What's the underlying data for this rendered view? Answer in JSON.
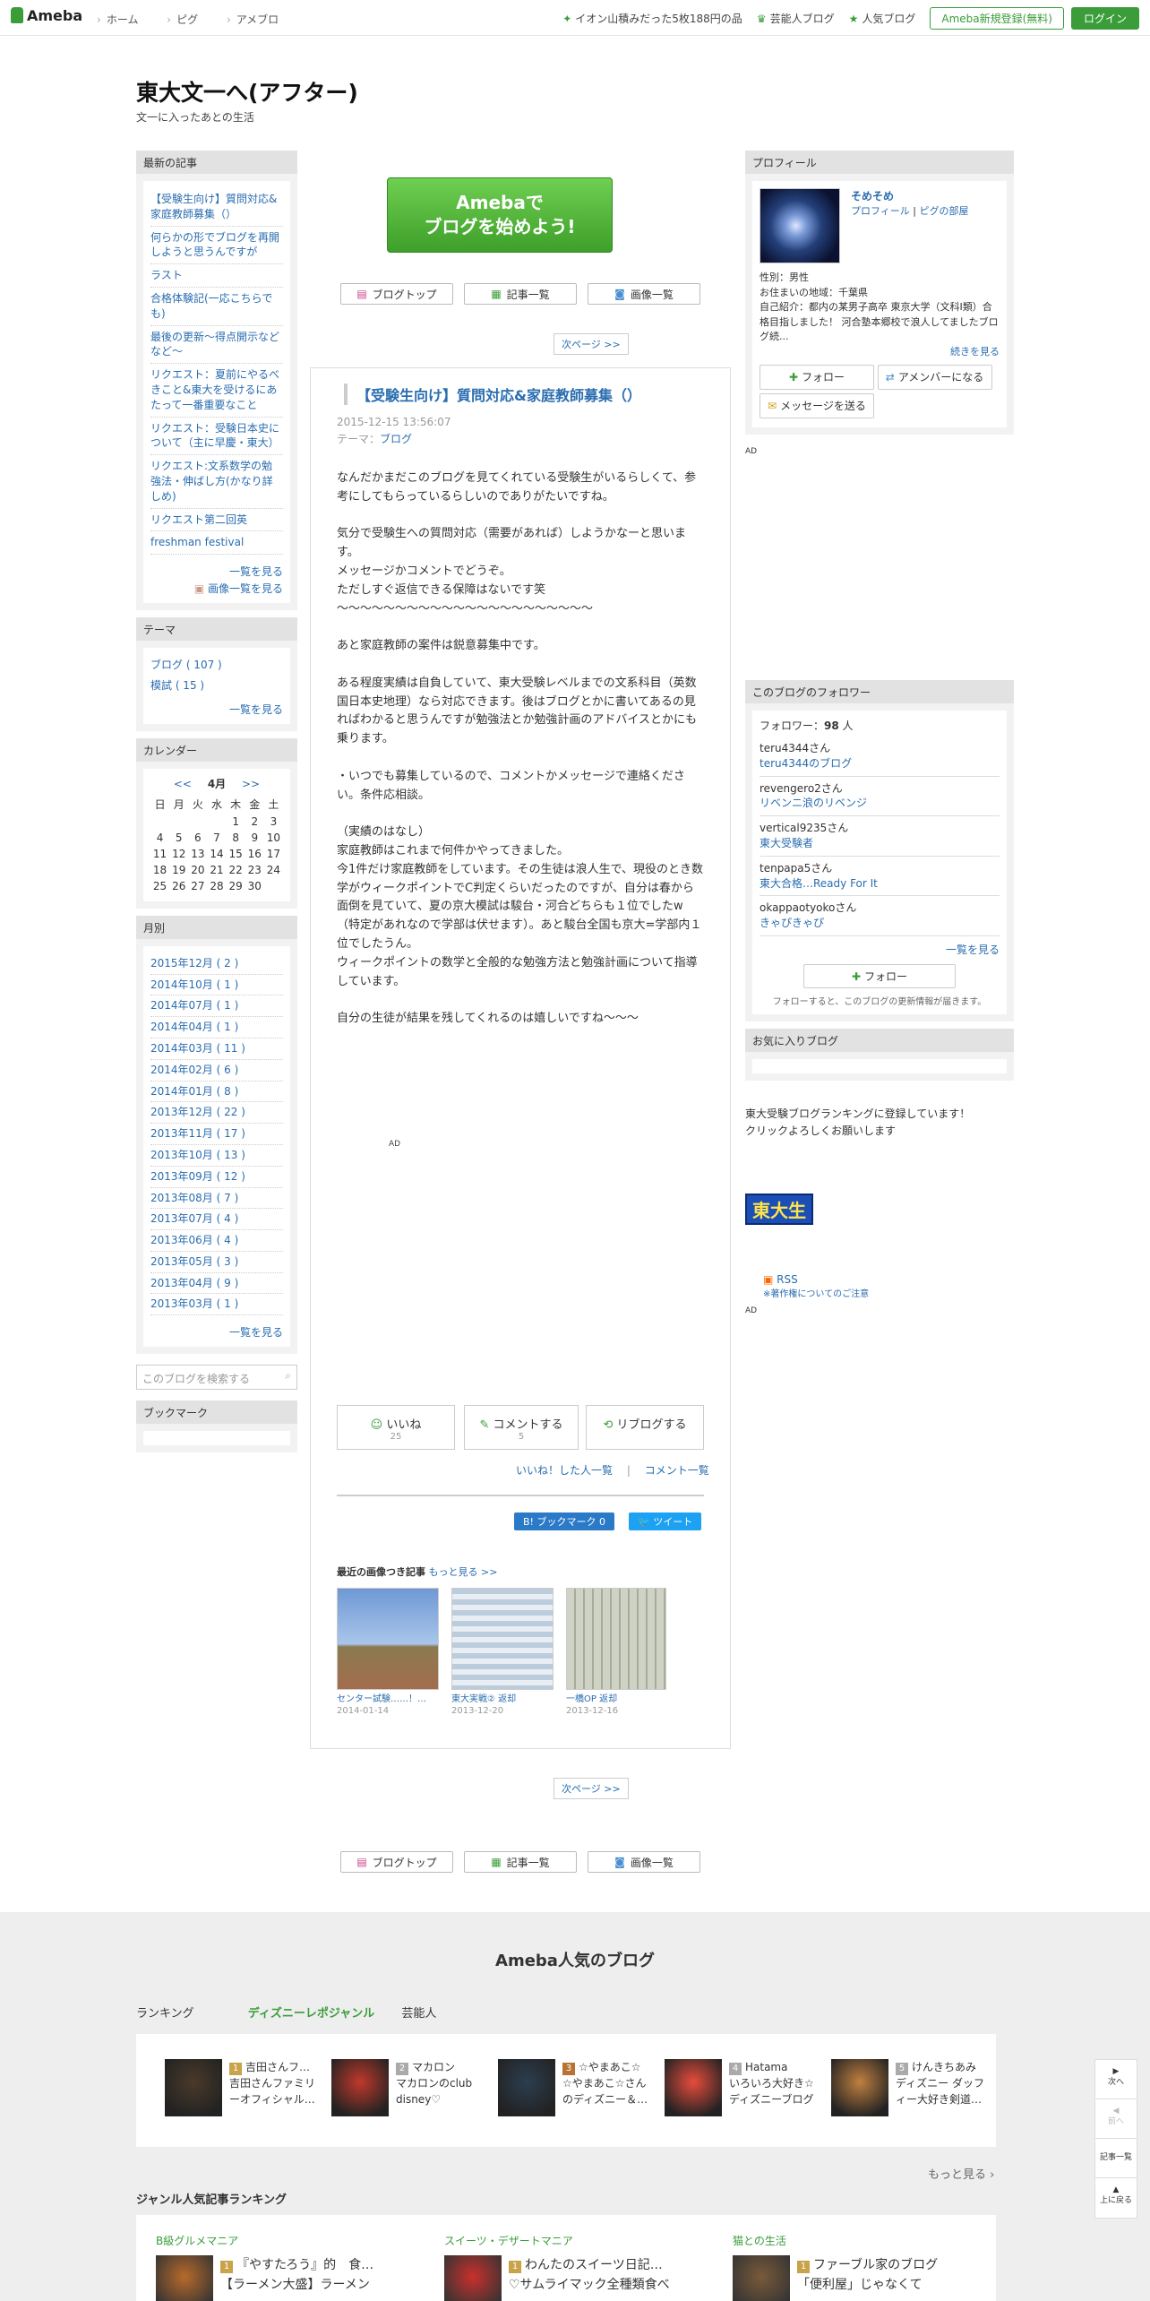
{
  "header": {
    "logo": "Ameba",
    "nav": [
      "ホーム",
      "ピグ",
      "アメブロ"
    ],
    "promo": "イオン山積みだった5枚188円の品",
    "links": [
      "芸能人ブログ",
      "人気ブログ"
    ],
    "register": "Ameba新規登録(無料)",
    "login": "ログイン"
  },
  "blog": {
    "title": "東大文一へ(アフター)",
    "description": "文一に入ったあとの生活"
  },
  "recent": {
    "heading": "最新の記事",
    "items": [
      "【受験生向け】質問対応&家庭教師募集（）",
      "何らかの形でブログを再開しようと思うんですが",
      "ラスト",
      "合格体験記(一応こちらでも)",
      "最後の更新～得点開示などなど～",
      "リクエスト：夏前にやるべきこと&東大を受けるにあたって一番重要なこと",
      "リクエスト：受験日本史について（主に早慶・東大）",
      "リクエスト:文系数学の勉強法・伸ばし方(かなり詳しめ)",
      "リクエスト第二回英",
      "freshman festival"
    ],
    "more": "一覧を見る",
    "images": "画像一覧を見る"
  },
  "theme": {
    "heading": "テーマ",
    "items": [
      "ブログ ( 107 )",
      "模試 ( 15 )"
    ],
    "more": "一覧を見る"
  },
  "calendar": {
    "heading": "カレンダー",
    "prev": "<<",
    "month": "4月",
    "next": ">>",
    "days": [
      "日",
      "月",
      "火",
      "水",
      "木",
      "金",
      "土"
    ],
    "weeks": [
      [
        "",
        "",
        "",
        "",
        "1",
        "2",
        "3"
      ],
      [
        "4",
        "5",
        "6",
        "7",
        "8",
        "9",
        "10"
      ],
      [
        "11",
        "12",
        "13",
        "14",
        "15",
        "16",
        "17"
      ],
      [
        "18",
        "19",
        "20",
        "21",
        "22",
        "23",
        "24"
      ],
      [
        "25",
        "26",
        "27",
        "28",
        "29",
        "30",
        ""
      ]
    ]
  },
  "monthly": {
    "heading": "月別",
    "items": [
      "2015年12月 ( 2 )",
      "2014年10月 ( 1 )",
      "2014年07月 ( 1 )",
      "2014年04月 ( 1 )",
      "2014年03月 ( 11 )",
      "2014年02月 ( 6 )",
      "2014年01月 ( 8 )",
      "2013年12月 ( 22 )",
      "2013年11月 ( 17 )",
      "2013年10月 ( 13 )",
      "2013年09月 ( 12 )",
      "2013年08月 ( 7 )",
      "2013年07月 ( 4 )",
      "2013年06月 ( 4 )",
      "2013年05月 ( 3 )",
      "2013年04月 ( 9 )",
      "2013年03月 ( 1 )"
    ],
    "more": "一覧を見る"
  },
  "search": {
    "placeholder": "このブログを検索する"
  },
  "bookmark": {
    "heading": "ブックマーク"
  },
  "center": {
    "banner_line1": "Amebaで",
    "banner_line2": "ブログを始めよう!",
    "nav": [
      "ブログトップ",
      "記事一覧",
      "画像一覧"
    ],
    "next": "次ページ >>"
  },
  "entry": {
    "title": "【受験生向け】質問対応&家庭教師募集（）",
    "date": "2015-12-15 13:56:07",
    "theme_label": "テーマ：",
    "theme": "ブログ",
    "body": "なんだかまだこのブログを見てくれている受験生がいるらしくて、参考にしてもらっているらしいのでありがたいですね。\n\n気分で受験生への質問対応（需要があれば）しようかなーと思います。\nメッセージかコメントでどうぞ。\nただしすぐ返信できる保障はないです笑\n～～～～～～～～～～～～～～～～～～～～～～\n\nあと家庭教師の案件は鋭意募集中です。\n\nある程度実績は自負していて、東大受験レベルまでの文系科目（英数国日本史地理）なら対応できます。後はブログとかに書いてあるの見ればわかると思うんですが勉強法とか勉強計画のアドバイスとかにも乗ります。\n\n・いつでも募集しているので、コメントかメッセージで連絡ください。条件応相談。\n\n（実績のはなし）\n家庭教師はこれまで何件かやってきました。\n今1件だけ家庭教師をしています。その生徒は浪人生で、現役のとき数学がウィークポイントでC判定くらいだったのですが、自分は春から面倒を見ていて、夏の京大模試は駿台・河合どちらも１位でしたw（特定があれなので学部は伏せます）。あと駿台全国も京大=学部内１位でしたうん。\nウィークポイントの数学と全般的な勉強方法と勉強計画について指導しています。\n\n自分の生徒が結果を残してくれるのは嬉しいですね～～～",
    "ad": "AD"
  },
  "actions": {
    "like": "いいね",
    "like_count": "25",
    "comment": "コメントする",
    "comment_count": "5",
    "reblog": "リブログする",
    "liked_list": "いいね！した人一覧",
    "comment_list": "コメント一覧",
    "bookmark": "B! ブックマーク  0",
    "tweet": "ツイート"
  },
  "recent_images": {
    "heading": "最近の画像つき記事",
    "more": "もっと見る >>",
    "items": [
      {
        "title": "センター試験……！…",
        "date": "2014-01-14"
      },
      {
        "title": "東大実戦② 返却",
        "date": "2013-12-20"
      },
      {
        "title": "一橋OP 返却",
        "date": "2013-12-16"
      }
    ]
  },
  "profile": {
    "heading": "プロフィール",
    "name": "そめそめ",
    "links": [
      "プロフィール",
      "ピグの部屋"
    ],
    "gender": "性別：男性",
    "area": "お住まいの地域：千葉県",
    "intro": "自己紹介：都内の某男子高卒 東京大学（文科Ⅰ類）合格目指しました！ 河合塾本郷校で浪人してましたブログ続...",
    "more": "続きを見る",
    "follow": "フォロー",
    "member": "アメンバーになる",
    "message": "メッセージを送る",
    "ad": "AD"
  },
  "followers": {
    "heading": "このブログのフォロワー",
    "count_label": "フォロワー：",
    "count": "98",
    "unit": "人",
    "items": [
      {
        "name": "teru4344さん",
        "blog": "teru4344のブログ"
      },
      {
        "name": "revengero2さん",
        "blog": "リベンニ浪のリベンジ"
      },
      {
        "name": "vertical9235さん",
        "blog": "東大受験者"
      },
      {
        "name": "tenpapa5さん",
        "blog": "東大合格…Ready For It"
      },
      {
        "name": "okappaotyokoさん",
        "blog": "きゃぴきゃぴ"
      }
    ],
    "more": "一覧を見る",
    "follow": "フォロー",
    "note": "フォローすると、このブログの更新情報が届きます。"
  },
  "favorites": {
    "heading": "お気に入りブログ"
  },
  "ranking_text": {
    "line1": "東大受験ブログランキングに登録しています！",
    "line2": "クリックよろしくお願いします",
    "badge": "東大生",
    "rss": "RSS",
    "copyright": "※著作権についてのご注意",
    "ad": "AD"
  },
  "footer": {
    "heading": "Ameba人気のブログ",
    "tabs": [
      "ランキング",
      "ディズニーレポジャンル",
      "芸能人"
    ],
    "items": [
      {
        "rank": "1",
        "name": "吉田さんフ…",
        "desc": "吉田さんファミリーオフィシャル…"
      },
      {
        "rank": "2",
        "name": "マカロン",
        "desc": "マカロンのclub disney♡"
      },
      {
        "rank": "3",
        "name": "☆やまあこ☆",
        "desc": "☆やまあこ☆さんのディズニー＆…"
      },
      {
        "rank": "4",
        "name": "Hatama",
        "desc": "いろいろ大好き☆ディズニーブログ"
      },
      {
        "rank": "5",
        "name": "けんきちあみ",
        "desc": "ディズニー ダッフィー大好き剣道…"
      }
    ],
    "more": "もっと見る",
    "genre_heading": "ジャンル人気記事ランキング",
    "genres": [
      {
        "title": "B級グルメマニア",
        "line1": "『やすたろう』的　食…",
        "line2": "【ラーメン大盛】ラーメン"
      },
      {
        "title": "スイーツ・デザートマニア",
        "line1": "わんたのスイーツ日記…",
        "line2": "♡サムライマック全種類食べ"
      },
      {
        "title": "猫との生活",
        "line1": "ファーブル家のブログ",
        "line2": "「便利屋」じゃなくて"
      }
    ]
  },
  "sidebtns": {
    "next": "次へ",
    "prev": "前へ",
    "list": "記事一覧",
    "top": "上に戻る"
  }
}
